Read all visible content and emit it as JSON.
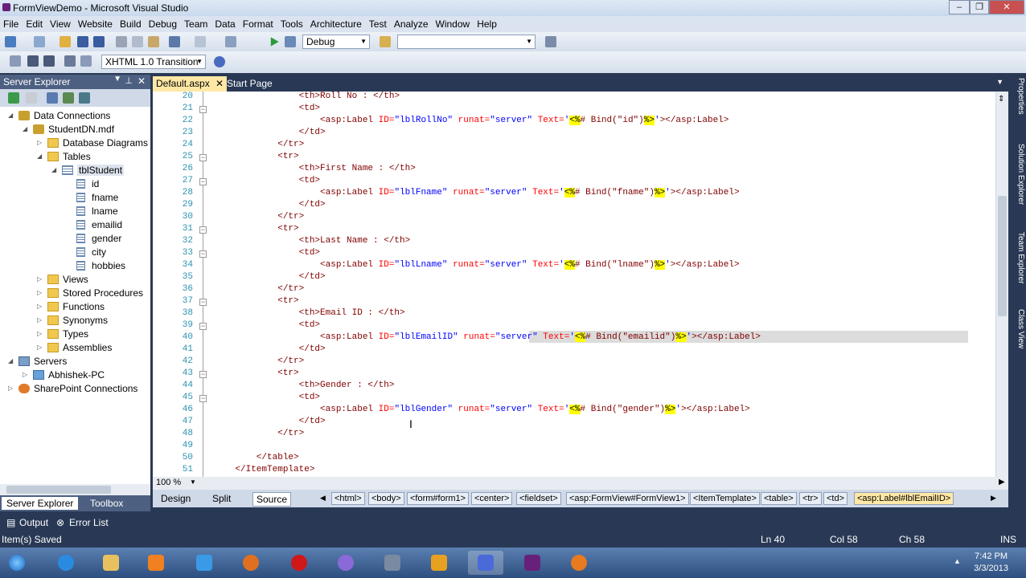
{
  "window": {
    "title": "FormViewDemo - Microsoft Visual Studio"
  },
  "menu": [
    "File",
    "Edit",
    "View",
    "Website",
    "Build",
    "Debug",
    "Team",
    "Data",
    "Format",
    "Tools",
    "Architecture",
    "Test",
    "Analyze",
    "Window",
    "Help"
  ],
  "toolbar": {
    "config": "Debug",
    "platform": "",
    "doctype": "XHTML 1.0 Transition"
  },
  "server_explorer": {
    "title": "Server Explorer",
    "tree": [
      {
        "label": "Data Connections",
        "icon": "database-icon"
      },
      {
        "label": "StudentDN.mdf",
        "icon": "database-icon"
      },
      {
        "label": "Database Diagrams",
        "icon": "folder-icon"
      },
      {
        "label": "Tables",
        "icon": "folder-icon"
      },
      {
        "label": "tblStudent",
        "icon": "table-icon"
      },
      {
        "label": "id",
        "icon": "column-icon"
      },
      {
        "label": "fname",
        "icon": "column-icon"
      },
      {
        "label": "lname",
        "icon": "column-icon"
      },
      {
        "label": "emailid",
        "icon": "column-icon"
      },
      {
        "label": "gender",
        "icon": "column-icon"
      },
      {
        "label": "city",
        "icon": "column-icon"
      },
      {
        "label": "hobbies",
        "icon": "column-icon"
      },
      {
        "label": "Views",
        "icon": "folder-icon"
      },
      {
        "label": "Stored Procedures",
        "icon": "folder-icon"
      },
      {
        "label": "Functions",
        "icon": "folder-icon"
      },
      {
        "label": "Synonyms",
        "icon": "folder-icon"
      },
      {
        "label": "Types",
        "icon": "folder-icon"
      },
      {
        "label": "Assemblies",
        "icon": "folder-icon"
      },
      {
        "label": "Servers",
        "icon": "server-icon"
      },
      {
        "label": "Abhishek-PC",
        "icon": "computer-icon"
      },
      {
        "label": "SharePoint Connections",
        "icon": "sharepoint-icon"
      }
    ],
    "tabs": [
      "Server Explorer",
      "Toolbox"
    ]
  },
  "editor": {
    "tabs": [
      "Default.aspx",
      "Start Page"
    ],
    "line_numbers": [
      "20",
      "21",
      "22",
      "23",
      "24",
      "25",
      "26",
      "27",
      "28",
      "29",
      "30",
      "31",
      "32",
      "33",
      "34",
      "35",
      "36",
      "37",
      "38",
      "39",
      "40",
      "41",
      "42",
      "43",
      "44",
      "45",
      "46",
      "47",
      "48",
      "49",
      "50",
      "51"
    ],
    "zoom": "100 %",
    "views": [
      "Design",
      "Split",
      "Source"
    ],
    "breadcrumbs": [
      "<html>",
      "<body>",
      "<form#form1>",
      "<center>",
      "<fieldset>",
      "<asp:FormView#FormView1>",
      "<ItemTemplate>",
      "<table>",
      "<tr>",
      "<td>",
      "<asp:Label#lblEmailID>"
    ]
  },
  "code_lines": [
    [
      [
        "                <",
        "tg"
      ],
      [
        "th",
        "tg"
      ],
      [
        ">Roll No : </",
        "tg"
      ],
      [
        "th",
        "tg"
      ],
      [
        ">",
        "tg"
      ]
    ],
    [
      [
        "                <td>",
        "tg"
      ]
    ],
    [
      [
        "                    <",
        "tg"
      ],
      [
        "asp:Label",
        "tg"
      ],
      [
        " ID=",
        "at"
      ],
      [
        "\"lblRollNo\"",
        "st"
      ],
      [
        " runat=",
        "at"
      ],
      [
        "\"server\"",
        "st"
      ],
      [
        " Text=",
        "at"
      ],
      [
        "'",
        "st"
      ],
      [
        "<%",
        "hl"
      ],
      [
        "# Bind(\"id\")",
        "tg"
      ],
      [
        "%>",
        "hl"
      ],
      [
        "'",
        "st"
      ],
      [
        "></asp:Label>",
        "tg"
      ]
    ],
    [
      [
        "                </td>",
        "tg"
      ]
    ],
    [
      [
        "            </tr>",
        "tg"
      ]
    ],
    [
      [
        "            <tr>",
        "tg"
      ]
    ],
    [
      [
        "                <th>First Name : </th>",
        "tg"
      ]
    ],
    [
      [
        "                <td>",
        "tg"
      ]
    ],
    [
      [
        "                    <asp:Label",
        "tg"
      ],
      [
        " ID=",
        "at"
      ],
      [
        "\"lblFname\"",
        "st"
      ],
      [
        " runat=",
        "at"
      ],
      [
        "\"server\"",
        "st"
      ],
      [
        " Text=",
        "at"
      ],
      [
        "'",
        "st"
      ],
      [
        "<%",
        "hl"
      ],
      [
        "# Bind(\"fname\")",
        "tg"
      ],
      [
        "%>",
        "hl"
      ],
      [
        "'",
        "st"
      ],
      [
        "></asp:Label>",
        "tg"
      ]
    ],
    [
      [
        "                </td>",
        "tg"
      ]
    ],
    [
      [
        "            </tr>",
        "tg"
      ]
    ],
    [
      [
        "            <tr>",
        "tg"
      ]
    ],
    [
      [
        "                <th>Last Name : </th>",
        "tg"
      ]
    ],
    [
      [
        "                <td>",
        "tg"
      ]
    ],
    [
      [
        "                    <asp:Label",
        "tg"
      ],
      [
        " ID=",
        "at"
      ],
      [
        "\"lblLname\"",
        "st"
      ],
      [
        " runat=",
        "at"
      ],
      [
        "\"server\"",
        "st"
      ],
      [
        " Text=",
        "at"
      ],
      [
        "'",
        "st"
      ],
      [
        "<%",
        "hl"
      ],
      [
        "# Bind(\"lname\")",
        "tg"
      ],
      [
        "%>",
        "hl"
      ],
      [
        "'",
        "st"
      ],
      [
        "></asp:Label>",
        "tg"
      ]
    ],
    [
      [
        "                </td>",
        "tg"
      ]
    ],
    [
      [
        "            </tr>",
        "tg"
      ]
    ],
    [
      [
        "            <tr>",
        "tg"
      ]
    ],
    [
      [
        "                <th>Email ID : </th>",
        "tg"
      ]
    ],
    [
      [
        "                <td>",
        "tg"
      ]
    ],
    [
      [
        "                    <asp:Label",
        "tg"
      ],
      [
        " ID=",
        "at"
      ],
      [
        "\"lblEmailID\"",
        "st"
      ],
      [
        " runat=",
        "at"
      ],
      [
        "\"server\"",
        "st"
      ],
      [
        " Text=",
        "at"
      ],
      [
        "'",
        "st"
      ],
      [
        "<%",
        "hl"
      ],
      [
        "# Bind(\"emailid\")",
        "tg"
      ],
      [
        "%>",
        "hl"
      ],
      [
        "'",
        "st"
      ],
      [
        "></asp:Label>",
        "tg"
      ]
    ],
    [
      [
        "                </td>",
        "tg"
      ]
    ],
    [
      [
        "            </tr>",
        "tg"
      ]
    ],
    [
      [
        "            <tr>",
        "tg"
      ]
    ],
    [
      [
        "                <th>Gender : </th>",
        "tg"
      ]
    ],
    [
      [
        "                <td>",
        "tg"
      ]
    ],
    [
      [
        "                    <asp:Label",
        "tg"
      ],
      [
        " ID=",
        "at"
      ],
      [
        "\"lblGender\"",
        "st"
      ],
      [
        " runat=",
        "at"
      ],
      [
        "\"server\"",
        "st"
      ],
      [
        " Text=",
        "at"
      ],
      [
        "'",
        "st"
      ],
      [
        "<%",
        "hl"
      ],
      [
        "# Bind(\"gender\")",
        "tg"
      ],
      [
        "%>",
        "hl"
      ],
      [
        "'",
        "st"
      ],
      [
        "></asp:Label>",
        "tg"
      ]
    ],
    [
      [
        "                </td>",
        "tg"
      ]
    ],
    [
      [
        "            </tr>",
        "tg"
      ]
    ],
    [
      [
        "",
        "tg"
      ]
    ],
    [
      [
        "        </table>",
        "tg"
      ]
    ],
    [
      [
        "    </ItemTemplate>",
        "tg"
      ]
    ]
  ],
  "bottom_tabs": [
    "Output",
    "Error List"
  ],
  "status": {
    "message": "Item(s) Saved",
    "ln": "Ln 40",
    "col": "Col 58",
    "ch": "Ch 58",
    "mode": "INS"
  },
  "right_panels": [
    "Properties",
    "Solution Explorer",
    "Team Explorer",
    "Class View"
  ],
  "clock": {
    "time": "7:42 PM",
    "date": "3/3/2013"
  }
}
